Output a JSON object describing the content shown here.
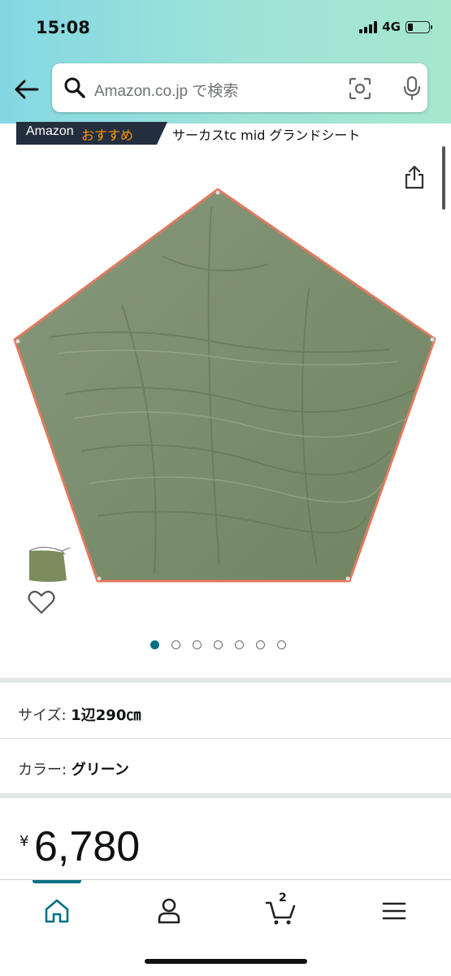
{
  "status_bar": {
    "time": "15:08",
    "network": "4G",
    "battery_level": 0.25
  },
  "search": {
    "placeholder": "Amazon.co.jp で検索"
  },
  "breadcrumb": {
    "amazon": "Amazon",
    "recommend": "おすすめ",
    "title": "サーカスtc mid グランドシート"
  },
  "image_carousel": {
    "total": 7,
    "active_index": 0
  },
  "options": [
    {
      "label": "サイズ: ",
      "value": "1辺290㎝"
    },
    {
      "label": "カラー: ",
      "value": "グリーン"
    }
  ],
  "price": {
    "currency": "¥",
    "amount": "6,780"
  },
  "cart": {
    "count": "2"
  },
  "colors": {
    "accent": "#007185",
    "badge_bg": "#232f3e",
    "badge_text": "#ff9900",
    "sheet": "#7d9070",
    "sheet_edge": "#e07a5f"
  }
}
